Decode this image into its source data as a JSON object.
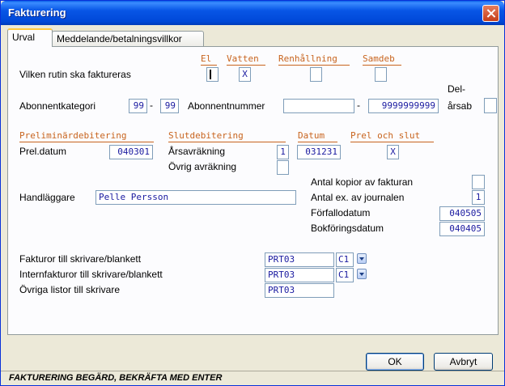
{
  "window": {
    "title": "Fakturering"
  },
  "tabs": [
    {
      "label": "Urval"
    },
    {
      "label": "Meddelande/betalningsvillkor"
    }
  ],
  "routine": {
    "question": "Vilken rutin ska faktureras",
    "headers": {
      "el": "El",
      "vatten": "Vatten",
      "renhallning": "Renhållning",
      "samdeb": "Samdeb"
    },
    "values": {
      "el": "",
      "vatten": "X",
      "renhallning": "",
      "samdeb": ""
    }
  },
  "abonnent": {
    "kategori_label": "Abonnentkategori",
    "kategori_from": "99",
    "kategori_to": "99",
    "dash": "-",
    "nummer_label": "Abonnentnummer",
    "nummer_from": "",
    "nummer_to": "9999999999",
    "delarsab_label_1": "Del-",
    "delarsab_label_2": "årsab",
    "delarsab_value": ""
  },
  "sections": {
    "prel": "Preliminärdebitering",
    "slut": "Slutdebitering",
    "datum": "Datum",
    "prel_slut": "Prel och slut"
  },
  "prel": {
    "datum_label": "Prel.datum",
    "datum_value": "040301"
  },
  "slut": {
    "arsavrakning_label": "Årsavräkning",
    "arsavrakning_value": "1",
    "ovrig_label": "Övrig avräkning",
    "ovrig_value": "",
    "datum_value": "031231",
    "prel_slut_value": "X"
  },
  "handlaggare": {
    "label": "Handläggare",
    "value": "Pelle Persson"
  },
  "right_block": {
    "kopior_label": "Antal kopior av fakturan",
    "kopior_value": "",
    "journal_label": "Antal ex. av journalen",
    "journal_value": "1",
    "forfallo_label": "Förfallodatum",
    "forfallo_value": "040505",
    "bokforing_label": "Bokföringsdatum",
    "bokforing_value": "040405"
  },
  "printers": {
    "fakturor_label": "Fakturor till skrivare/blankett",
    "fakturor_printer": "PRT03",
    "fakturor_form": "C1",
    "intern_label": "Internfakturor till skrivare/blankett",
    "intern_printer": "PRT03",
    "intern_form": "C1",
    "ovriga_label": "Övriga listor till skrivare",
    "ovriga_printer": "PRT03"
  },
  "buttons": {
    "ok": "OK",
    "cancel": "Avbryt"
  },
  "status": "FAKTURERING BEGÄRD, BEKRÄFTA MED ENTER"
}
